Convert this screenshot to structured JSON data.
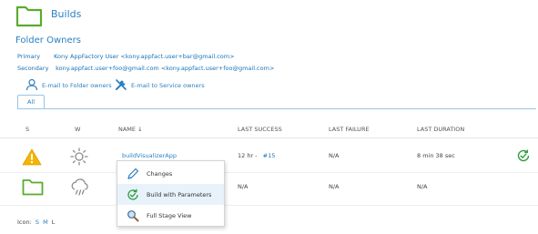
{
  "header": {
    "title": "Builds"
  },
  "owners": {
    "section_title": "Folder Owners",
    "primary_label": "Primary",
    "primary_value": "Kony AppFactory User <kony.appfact.user+bar@gmail.com>",
    "secondary_label": "Secondary",
    "secondary_value": "kony.appfact.user+foo@gmail.com <kony.appfact.user+foo@gmail.com>"
  },
  "actions": {
    "email_folder_owners": "E-mail to Folder owners",
    "email_service_owners": "E-mail to Service owners"
  },
  "tabs": [
    {
      "label": "All"
    }
  ],
  "table": {
    "columns": {
      "s": "S",
      "w": "W",
      "name": "NAME ↓",
      "last_success": "LAST SUCCESS",
      "last_failure": "LAST FAILURE",
      "last_duration": "LAST DURATION"
    },
    "rows": [
      {
        "name": "buildVisualizerApp",
        "last_success": "12 hr -",
        "last_success_build": "#15",
        "last_failure": "N/A",
        "last_duration": "8 min 38 sec"
      },
      {
        "name": "",
        "last_success": "N/A",
        "last_success_build": "",
        "last_failure": "N/A",
        "last_duration": "N/A"
      }
    ]
  },
  "context_menu": {
    "items": [
      {
        "label": "Changes",
        "icon": "pencil-icon"
      },
      {
        "label": "Build with Parameters",
        "icon": "clock-arrow-icon"
      },
      {
        "label": "Full Stage View",
        "icon": "magnifier-icon"
      }
    ]
  },
  "icon_size": {
    "label": "Icon:",
    "s": "S",
    "m": "M",
    "l": "L"
  },
  "colors": {
    "accent": "#2a7fc1",
    "folder_green": "#5aab2e",
    "warning_yellow": "#f5b400",
    "tab_border": "#9bc4e6"
  }
}
